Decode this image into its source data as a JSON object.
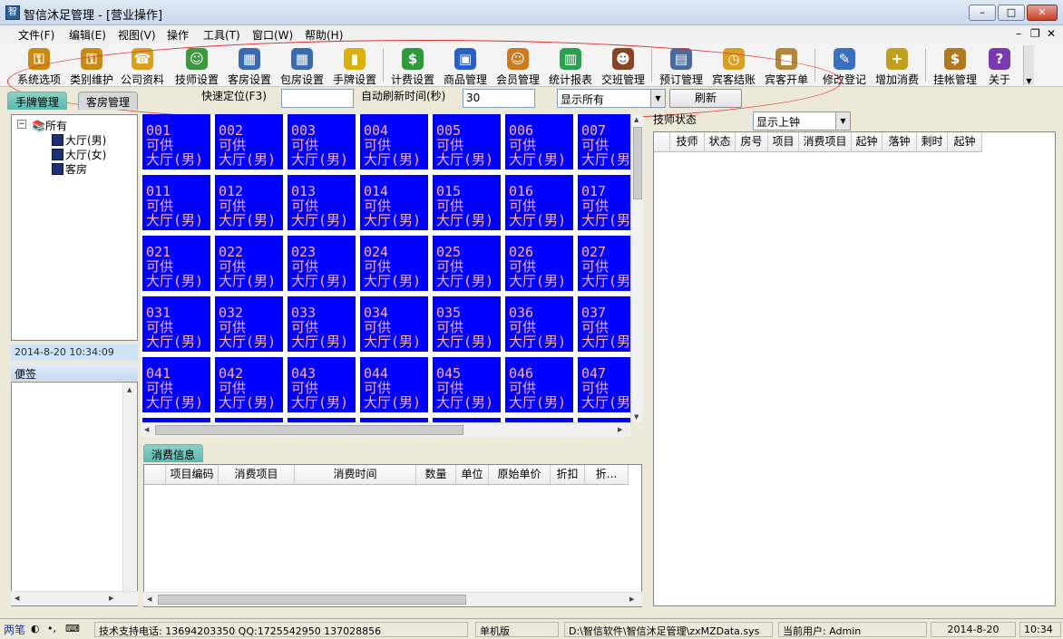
{
  "window": {
    "title": "智信沐足管理 - [营业操作]"
  },
  "menu": [
    "文件(F)",
    "编辑(E)",
    "视图(V)",
    "操作",
    "工具(T)",
    "窗口(W)",
    "帮助(H)"
  ],
  "toolbar": [
    {
      "label": "系统选项",
      "icon": "keys-icon",
      "color": "#c98a14"
    },
    {
      "label": "类别维护",
      "icon": "keys-icon",
      "color": "#c98a14"
    },
    {
      "label": "公司资料",
      "icon": "phone-icon",
      "color": "#d9a020"
    },
    {
      "label": "技师设置",
      "icon": "person-icon",
      "color": "#3c9a3c"
    },
    {
      "label": "客房设置",
      "icon": "rooms-icon",
      "color": "#3a6ab0"
    },
    {
      "label": "包房设置",
      "icon": "rooms-icon",
      "color": "#3a6ab0"
    },
    {
      "label": "手牌设置",
      "icon": "tag-icon",
      "color": "#d9b010"
    },
    {
      "label": "计费设置",
      "icon": "money-icon",
      "color": "#2e9a3a"
    },
    {
      "label": "商品管理",
      "icon": "box-icon",
      "color": "#2a5fc8"
    },
    {
      "label": "会员管理",
      "icon": "member-icon",
      "color": "#d07a20"
    },
    {
      "label": "统计报表",
      "icon": "chart-icon",
      "color": "#2aa050"
    },
    {
      "label": "交班管理",
      "icon": "group-icon",
      "color": "#884422"
    },
    {
      "label": "预订管理",
      "icon": "printer-icon",
      "color": "#4a6aa0"
    },
    {
      "label": "宾客结账",
      "icon": "clock-icon",
      "color": "#d8a020"
    },
    {
      "label": "宾客开单",
      "icon": "package-icon",
      "color": "#b08a3a"
    },
    {
      "label": "修改登记",
      "icon": "edit-user-icon",
      "color": "#3a70c0"
    },
    {
      "label": "增加消费",
      "icon": "add-icon",
      "color": "#c0a020"
    },
    {
      "label": "挂帐管理",
      "icon": "moneybag-icon",
      "color": "#b07820"
    },
    {
      "label": "关于",
      "icon": "help-icon",
      "color": "#7a3ab0"
    }
  ],
  "tabs": {
    "handcard": "手牌管理",
    "room": "客房管理"
  },
  "quick_locate": {
    "label": "快速定位(F3)",
    "value": ""
  },
  "auto_refresh": {
    "label": "自动刷新时间(秒)",
    "value": "30"
  },
  "filter_select": "显示所有",
  "refresh_button": "刷新",
  "tree": {
    "root": "所有",
    "children": [
      "大厅(男)",
      "大厅(女)",
      "客房"
    ]
  },
  "datetime": "2014-8-20 10:34:09",
  "memo_label": "便签",
  "rooms": [
    [
      "001",
      "002",
      "003",
      "004",
      "005",
      "006",
      "007"
    ],
    [
      "011",
      "012",
      "013",
      "014",
      "015",
      "016",
      "017"
    ],
    [
      "021",
      "022",
      "023",
      "024",
      "025",
      "026",
      "027"
    ],
    [
      "031",
      "032",
      "033",
      "034",
      "035",
      "036",
      "037"
    ],
    [
      "041",
      "042",
      "043",
      "044",
      "045",
      "046",
      "047"
    ]
  ],
  "room_status": "可供",
  "room_area": "大厅(男)",
  "room_color": "#0000ff",
  "consumption": {
    "tab": "消费信息",
    "columns": [
      "项目编码",
      "消费项目",
      "消费时间",
      "数量",
      "单位",
      "原始单价",
      "折扣",
      "折..."
    ]
  },
  "technician": {
    "label": "技师状态",
    "filter": "显示上钟",
    "columns": [
      "技师",
      "状态",
      "房号",
      "项目",
      "消费项目",
      "起钟",
      "落钟",
      "剩时",
      "起钟"
    ]
  },
  "statusbar": {
    "ime": "两笔",
    "support": "技术支持电话: 13694203350 QQ:1725542950 137028856",
    "edition": "单机版",
    "db_path": "D:\\智信软件\\智信沐足管理\\zxMZData.sys",
    "user": "当前用户: Admin",
    "date": "2014-8-20",
    "time": "10:34"
  }
}
